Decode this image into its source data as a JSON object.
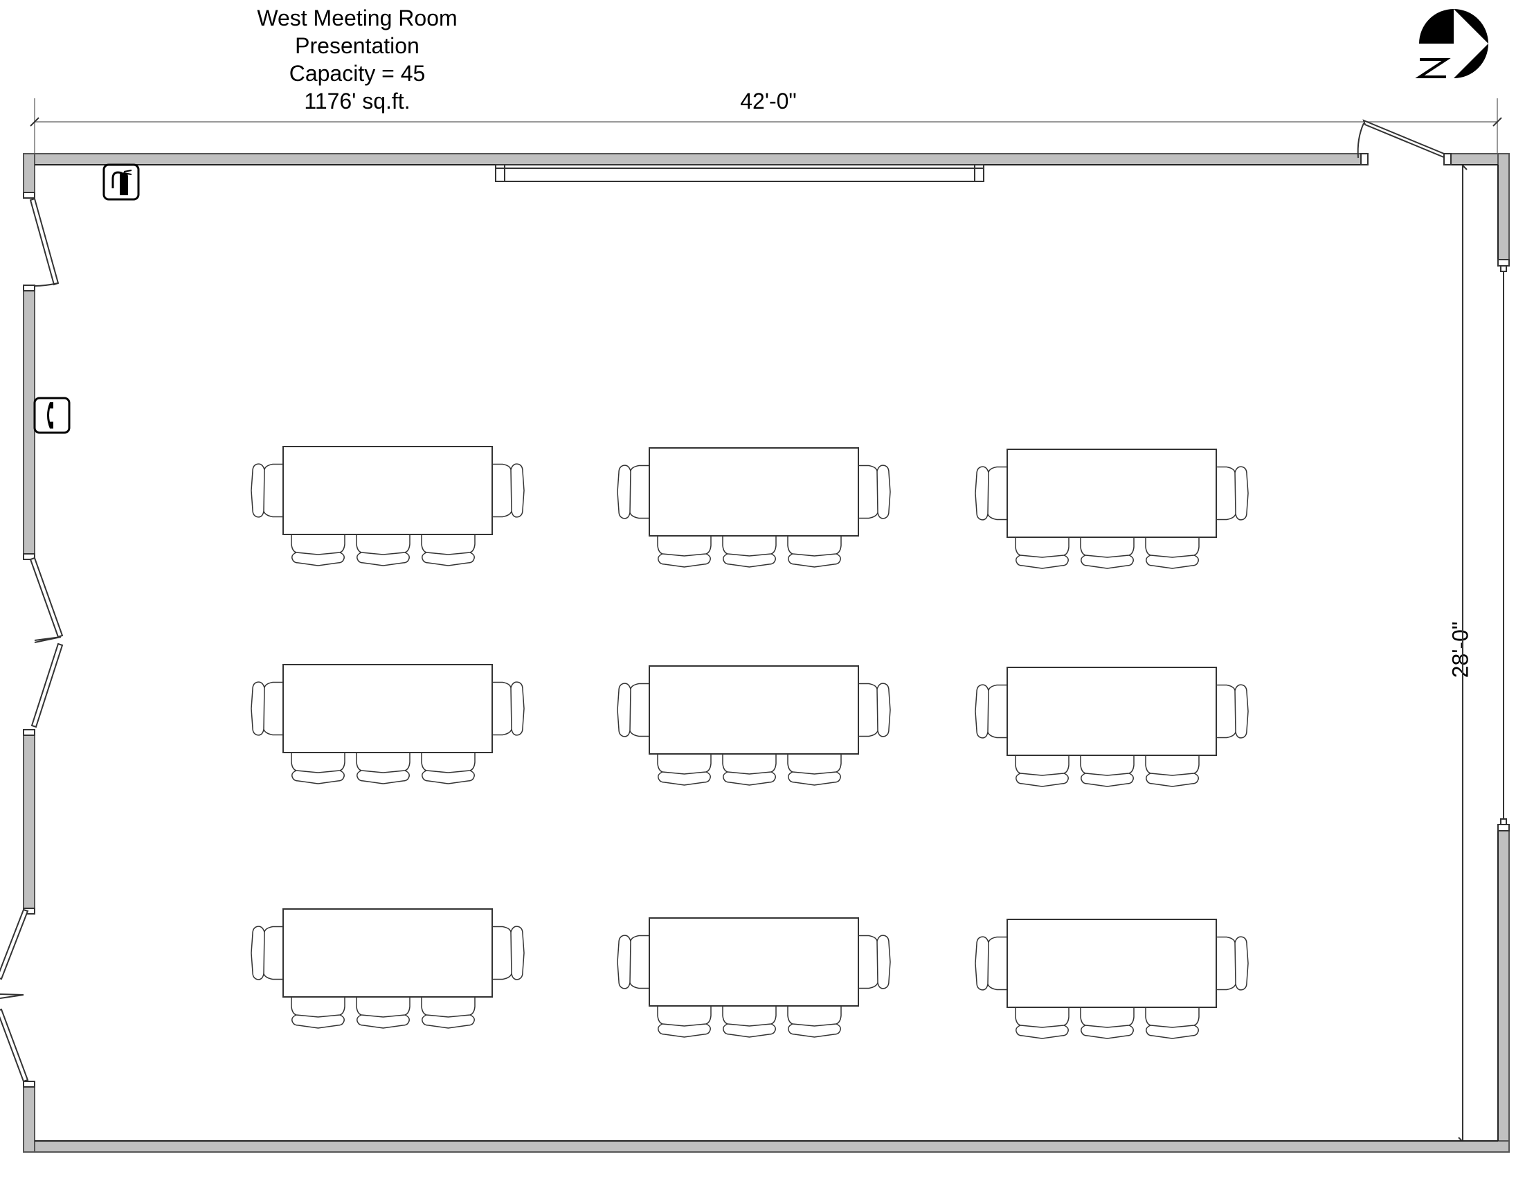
{
  "room": {
    "name": "West Meeting Room",
    "setup": "Presentation",
    "capacity_label": "Capacity = 45",
    "area_label": "1176' sq.ft."
  },
  "dimensions": {
    "width_label": "42'-0\"",
    "depth_label": "28'-0\""
  },
  "north_arrow": {
    "label": "N",
    "icon": "north-arrow-icon"
  },
  "fixtures": [
    {
      "name": "fire-extinguisher",
      "icon": "fire-extinguisher-icon"
    },
    {
      "name": "telephone",
      "icon": "telephone-icon"
    },
    {
      "name": "presentation-screen",
      "icon": "screen-icon"
    }
  ],
  "doors": [
    {
      "wall": "west",
      "type": "single"
    },
    {
      "wall": "west",
      "type": "double"
    },
    {
      "wall": "west",
      "type": "double"
    },
    {
      "wall": "north",
      "type": "single"
    },
    {
      "wall": "east",
      "type": "opening"
    }
  ],
  "layout": {
    "rows": 3,
    "columns": 3,
    "chairs_per_table": 5,
    "tables": [
      {
        "row": 1,
        "col": 1,
        "chairs": 5
      },
      {
        "row": 1,
        "col": 2,
        "chairs": 5
      },
      {
        "row": 1,
        "col": 3,
        "chairs": 5
      },
      {
        "row": 2,
        "col": 1,
        "chairs": 5
      },
      {
        "row": 2,
        "col": 2,
        "chairs": 5
      },
      {
        "row": 2,
        "col": 3,
        "chairs": 5
      },
      {
        "row": 3,
        "col": 1,
        "chairs": 5
      },
      {
        "row": 3,
        "col": 2,
        "chairs": 5
      },
      {
        "row": 3,
        "col": 3,
        "chairs": 5
      }
    ]
  },
  "colors": {
    "wall_fill": "#c0c0c0",
    "line": "#333333",
    "dimension_line": "#999999"
  }
}
